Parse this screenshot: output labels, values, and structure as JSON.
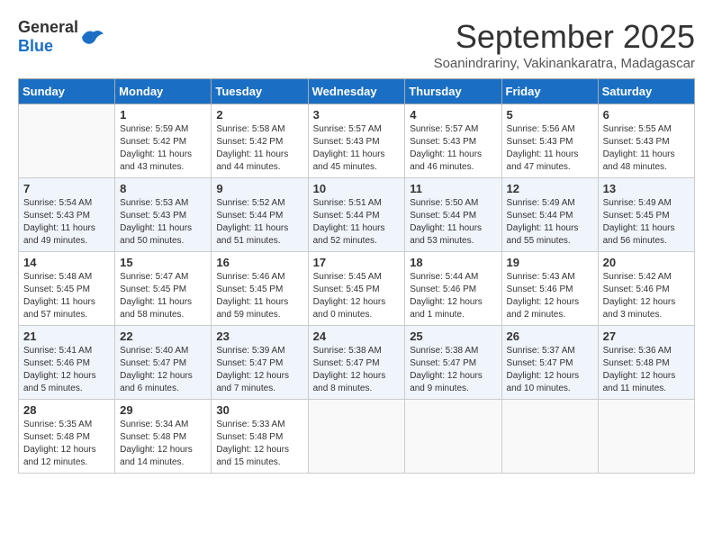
{
  "header": {
    "logo_general": "General",
    "logo_blue": "Blue",
    "month_title": "September 2025",
    "subtitle": "Soanindrariny, Vakinankaratra, Madagascar"
  },
  "days_of_week": [
    "Sunday",
    "Monday",
    "Tuesday",
    "Wednesday",
    "Thursday",
    "Friday",
    "Saturday"
  ],
  "weeks": [
    [
      {
        "day": "",
        "sunrise": "",
        "sunset": "",
        "daylight": ""
      },
      {
        "day": "1",
        "sunrise": "Sunrise: 5:59 AM",
        "sunset": "Sunset: 5:42 PM",
        "daylight": "Daylight: 11 hours and 43 minutes."
      },
      {
        "day": "2",
        "sunrise": "Sunrise: 5:58 AM",
        "sunset": "Sunset: 5:42 PM",
        "daylight": "Daylight: 11 hours and 44 minutes."
      },
      {
        "day": "3",
        "sunrise": "Sunrise: 5:57 AM",
        "sunset": "Sunset: 5:43 PM",
        "daylight": "Daylight: 11 hours and 45 minutes."
      },
      {
        "day": "4",
        "sunrise": "Sunrise: 5:57 AM",
        "sunset": "Sunset: 5:43 PM",
        "daylight": "Daylight: 11 hours and 46 minutes."
      },
      {
        "day": "5",
        "sunrise": "Sunrise: 5:56 AM",
        "sunset": "Sunset: 5:43 PM",
        "daylight": "Daylight: 11 hours and 47 minutes."
      },
      {
        "day": "6",
        "sunrise": "Sunrise: 5:55 AM",
        "sunset": "Sunset: 5:43 PM",
        "daylight": "Daylight: 11 hours and 48 minutes."
      }
    ],
    [
      {
        "day": "7",
        "sunrise": "Sunrise: 5:54 AM",
        "sunset": "Sunset: 5:43 PM",
        "daylight": "Daylight: 11 hours and 49 minutes."
      },
      {
        "day": "8",
        "sunrise": "Sunrise: 5:53 AM",
        "sunset": "Sunset: 5:43 PM",
        "daylight": "Daylight: 11 hours and 50 minutes."
      },
      {
        "day": "9",
        "sunrise": "Sunrise: 5:52 AM",
        "sunset": "Sunset: 5:44 PM",
        "daylight": "Daylight: 11 hours and 51 minutes."
      },
      {
        "day": "10",
        "sunrise": "Sunrise: 5:51 AM",
        "sunset": "Sunset: 5:44 PM",
        "daylight": "Daylight: 11 hours and 52 minutes."
      },
      {
        "day": "11",
        "sunrise": "Sunrise: 5:50 AM",
        "sunset": "Sunset: 5:44 PM",
        "daylight": "Daylight: 11 hours and 53 minutes."
      },
      {
        "day": "12",
        "sunrise": "Sunrise: 5:49 AM",
        "sunset": "Sunset: 5:44 PM",
        "daylight": "Daylight: 11 hours and 55 minutes."
      },
      {
        "day": "13",
        "sunrise": "Sunrise: 5:49 AM",
        "sunset": "Sunset: 5:45 PM",
        "daylight": "Daylight: 11 hours and 56 minutes."
      }
    ],
    [
      {
        "day": "14",
        "sunrise": "Sunrise: 5:48 AM",
        "sunset": "Sunset: 5:45 PM",
        "daylight": "Daylight: 11 hours and 57 minutes."
      },
      {
        "day": "15",
        "sunrise": "Sunrise: 5:47 AM",
        "sunset": "Sunset: 5:45 PM",
        "daylight": "Daylight: 11 hours and 58 minutes."
      },
      {
        "day": "16",
        "sunrise": "Sunrise: 5:46 AM",
        "sunset": "Sunset: 5:45 PM",
        "daylight": "Daylight: 11 hours and 59 minutes."
      },
      {
        "day": "17",
        "sunrise": "Sunrise: 5:45 AM",
        "sunset": "Sunset: 5:45 PM",
        "daylight": "Daylight: 12 hours and 0 minutes."
      },
      {
        "day": "18",
        "sunrise": "Sunrise: 5:44 AM",
        "sunset": "Sunset: 5:46 PM",
        "daylight": "Daylight: 12 hours and 1 minute."
      },
      {
        "day": "19",
        "sunrise": "Sunrise: 5:43 AM",
        "sunset": "Sunset: 5:46 PM",
        "daylight": "Daylight: 12 hours and 2 minutes."
      },
      {
        "day": "20",
        "sunrise": "Sunrise: 5:42 AM",
        "sunset": "Sunset: 5:46 PM",
        "daylight": "Daylight: 12 hours and 3 minutes."
      }
    ],
    [
      {
        "day": "21",
        "sunrise": "Sunrise: 5:41 AM",
        "sunset": "Sunset: 5:46 PM",
        "daylight": "Daylight: 12 hours and 5 minutes."
      },
      {
        "day": "22",
        "sunrise": "Sunrise: 5:40 AM",
        "sunset": "Sunset: 5:47 PM",
        "daylight": "Daylight: 12 hours and 6 minutes."
      },
      {
        "day": "23",
        "sunrise": "Sunrise: 5:39 AM",
        "sunset": "Sunset: 5:47 PM",
        "daylight": "Daylight: 12 hours and 7 minutes."
      },
      {
        "day": "24",
        "sunrise": "Sunrise: 5:38 AM",
        "sunset": "Sunset: 5:47 PM",
        "daylight": "Daylight: 12 hours and 8 minutes."
      },
      {
        "day": "25",
        "sunrise": "Sunrise: 5:38 AM",
        "sunset": "Sunset: 5:47 PM",
        "daylight": "Daylight: 12 hours and 9 minutes."
      },
      {
        "day": "26",
        "sunrise": "Sunrise: 5:37 AM",
        "sunset": "Sunset: 5:47 PM",
        "daylight": "Daylight: 12 hours and 10 minutes."
      },
      {
        "day": "27",
        "sunrise": "Sunrise: 5:36 AM",
        "sunset": "Sunset: 5:48 PM",
        "daylight": "Daylight: 12 hours and 11 minutes."
      }
    ],
    [
      {
        "day": "28",
        "sunrise": "Sunrise: 5:35 AM",
        "sunset": "Sunset: 5:48 PM",
        "daylight": "Daylight: 12 hours and 12 minutes."
      },
      {
        "day": "29",
        "sunrise": "Sunrise: 5:34 AM",
        "sunset": "Sunset: 5:48 PM",
        "daylight": "Daylight: 12 hours and 14 minutes."
      },
      {
        "day": "30",
        "sunrise": "Sunrise: 5:33 AM",
        "sunset": "Sunset: 5:48 PM",
        "daylight": "Daylight: 12 hours and 15 minutes."
      },
      {
        "day": "",
        "sunrise": "",
        "sunset": "",
        "daylight": ""
      },
      {
        "day": "",
        "sunrise": "",
        "sunset": "",
        "daylight": ""
      },
      {
        "day": "",
        "sunrise": "",
        "sunset": "",
        "daylight": ""
      },
      {
        "day": "",
        "sunrise": "",
        "sunset": "",
        "daylight": ""
      }
    ]
  ]
}
